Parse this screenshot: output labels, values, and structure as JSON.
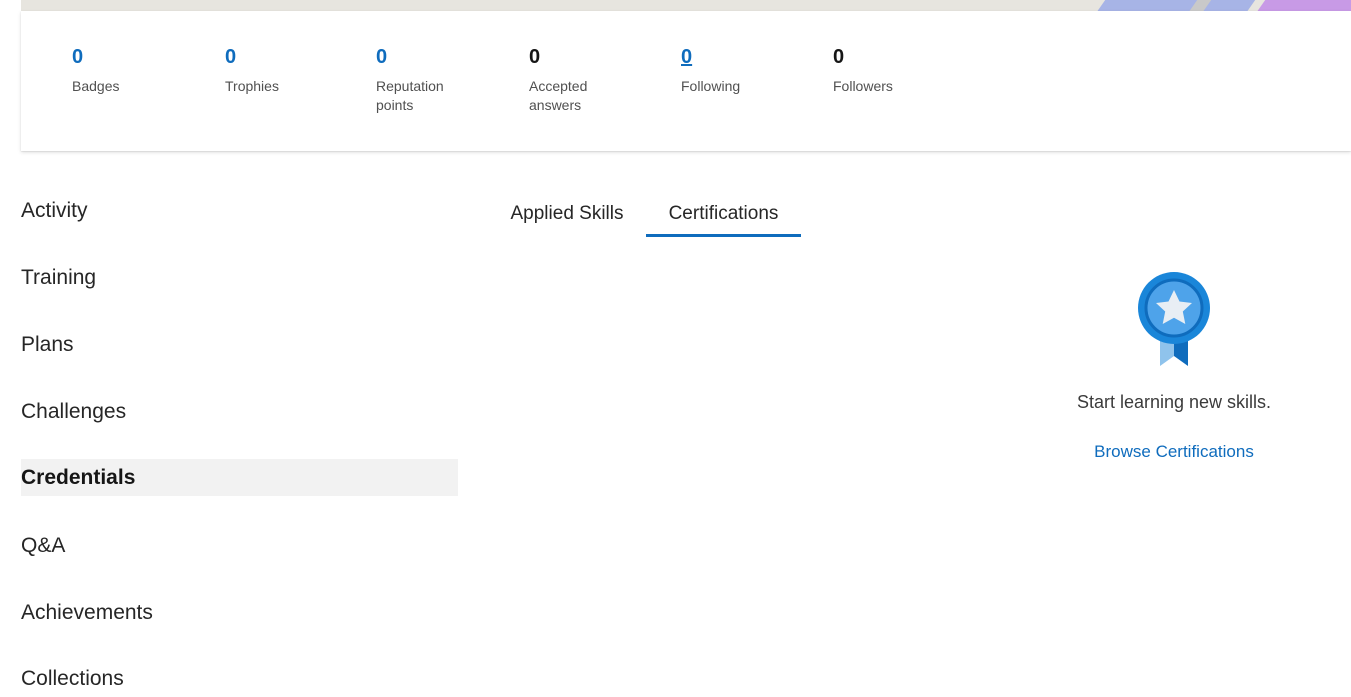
{
  "stats": [
    {
      "value": "0",
      "label": "Badges"
    },
    {
      "value": "0",
      "label": "Trophies"
    },
    {
      "value": "0",
      "label": "Reputation points"
    },
    {
      "value": "0",
      "label": "Accepted answers"
    },
    {
      "value": "0",
      "label": "Following"
    },
    {
      "value": "0",
      "label": "Followers"
    }
  ],
  "nav": {
    "items": [
      {
        "label": "Activity"
      },
      {
        "label": "Training"
      },
      {
        "label": "Plans"
      },
      {
        "label": "Challenges"
      },
      {
        "label": "Credentials"
      },
      {
        "label": "Q&A"
      },
      {
        "label": "Achievements"
      },
      {
        "label": "Collections"
      }
    ],
    "active": "Credentials"
  },
  "tabs": {
    "items": [
      {
        "label": "Applied Skills"
      },
      {
        "label": "Certifications"
      }
    ],
    "selected": "Certifications"
  },
  "empty_state": {
    "icon": "award-ribbon-icon",
    "message": "Start learning new skills.",
    "link_label": "Browse Certifications"
  },
  "colors": {
    "accent": "#0f6cbd",
    "active_nav_bg": "#f2f2f2"
  }
}
